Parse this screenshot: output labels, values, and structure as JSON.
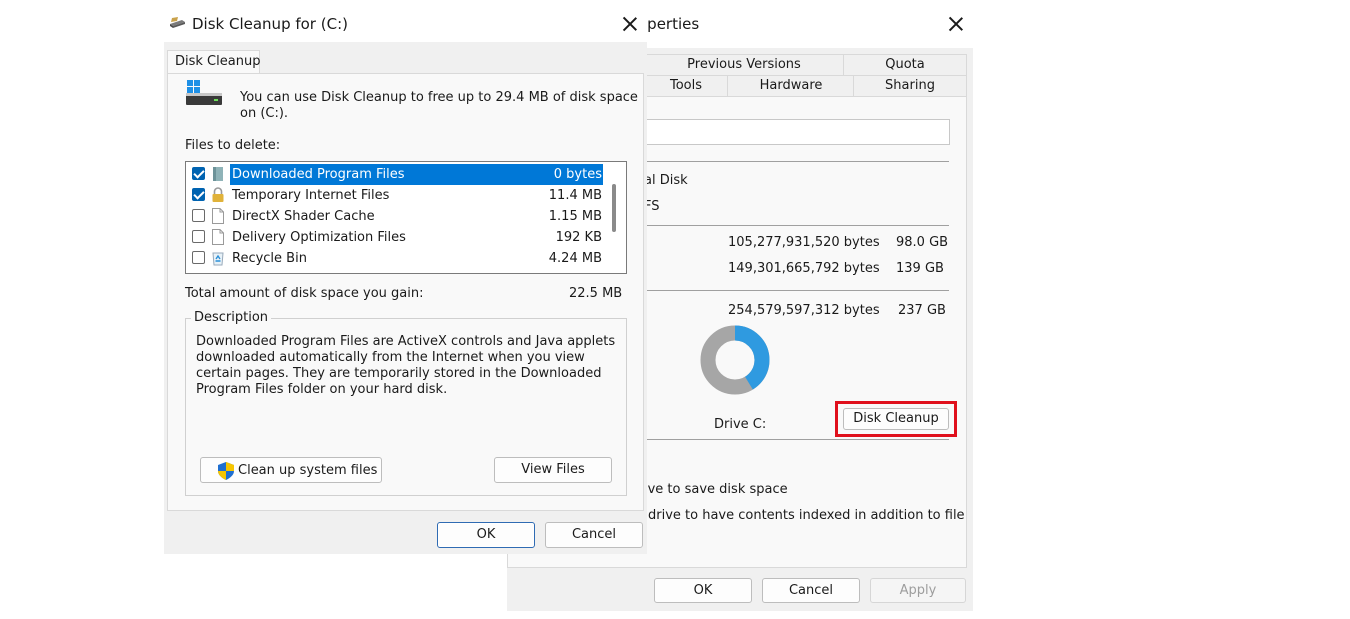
{
  "properties_window": {
    "title_partial": "operties",
    "tabs_row1": [
      "Previous Versions",
      "Quota"
    ],
    "tabs_row2": [
      "Tools",
      "Hardware",
      "Sharing"
    ],
    "type_partial": "al Disk",
    "filesystem_partial": "FS",
    "used_bytes": "105,277,931,520 bytes",
    "used_gb": "98.0 GB",
    "free_bytes": "149,301,665,792 bytes",
    "free_gb": "139 GB",
    "capacity_bytes": "254,579,597,312 bytes",
    "capacity_gb": "237 GB",
    "used_fraction": 0.413,
    "drive_label": "Drive C:",
    "disk_cleanup_button": "Disk Cleanup",
    "compress_partial": "ive to save disk space",
    "index_partial": "drive to have contents indexed in addition to file",
    "ok": "OK",
    "cancel": "Cancel",
    "apply": "Apply",
    "colors": {
      "used": "#2f9ae0",
      "free": "#a6a6a6",
      "highlight": "#e0101c"
    }
  },
  "disk_cleanup": {
    "title": "Disk Cleanup for  (C:)",
    "tab": "Disk Cleanup",
    "intro": "You can use Disk Cleanup to free up to 29.4 MB of disk space on (C:).",
    "files_label": "Files to delete:",
    "files": [
      {
        "name": "Downloaded Program Files",
        "size": "0 bytes",
        "checked": true,
        "selected": true,
        "icon": "folder-icon"
      },
      {
        "name": "Temporary Internet Files",
        "size": "11.4 MB",
        "checked": true,
        "selected": false,
        "icon": "lock-icon"
      },
      {
        "name": "DirectX Shader Cache",
        "size": "1.15 MB",
        "checked": false,
        "selected": false,
        "icon": "file-icon"
      },
      {
        "name": "Delivery Optimization Files",
        "size": "192 KB",
        "checked": false,
        "selected": false,
        "icon": "file-icon"
      },
      {
        "name": "Recycle Bin",
        "size": "4.24 MB",
        "checked": false,
        "selected": false,
        "icon": "recycle-bin-icon"
      }
    ],
    "total_label": "Total amount of disk space you gain:",
    "total_value": "22.5 MB",
    "description_label": "Description",
    "description_text": "Downloaded Program Files are ActiveX controls and Java applets downloaded automatically from the Internet when you view certain pages. They are temporarily stored in the Downloaded Program Files folder on your hard disk.",
    "cleanup_system_button": "Clean up system files",
    "view_files_button": "View Files",
    "ok": "OK",
    "cancel": "Cancel"
  }
}
